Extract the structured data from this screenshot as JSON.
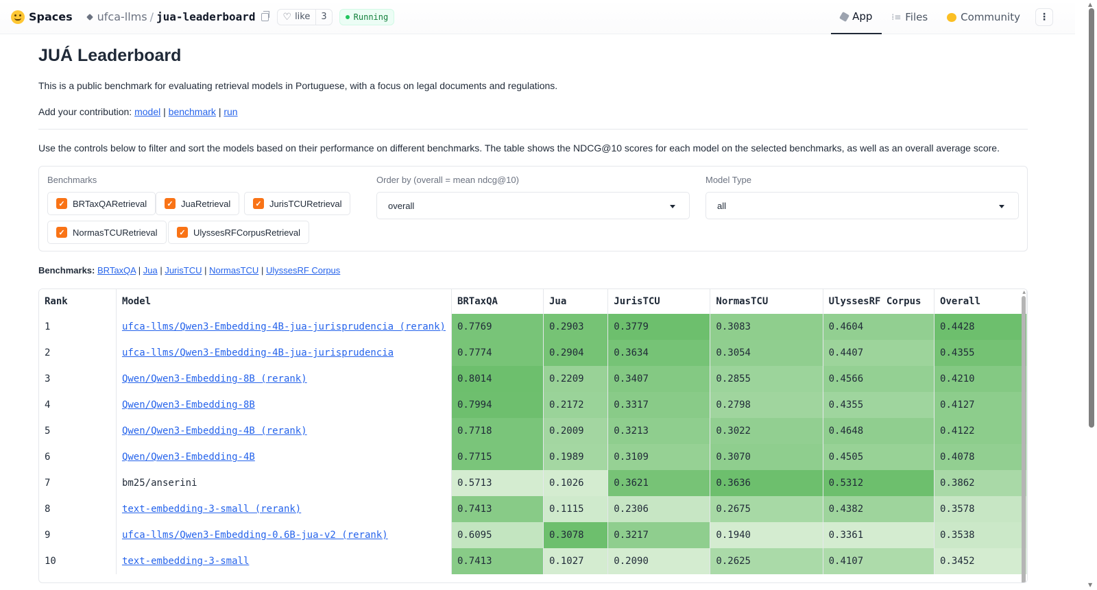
{
  "header": {
    "brand": "Spaces",
    "org": "ufca-llms",
    "repo": "jua-leaderboard",
    "like_label": "like",
    "like_count": "3",
    "status": "Running",
    "tabs": [
      {
        "label": "App",
        "icon": "app-icon",
        "active": true
      },
      {
        "label": "Files",
        "icon": "files-icon",
        "active": false
      },
      {
        "label": "Community",
        "icon": "community-icon",
        "active": false
      }
    ]
  },
  "page": {
    "title": "JUÁ Leaderboard",
    "description": "This is a public benchmark for evaluating retrieval models in Portuguese, with a focus on legal documents and regulations.",
    "contrib_prefix": "Add your contribution: ",
    "contrib_links": [
      "model",
      "benchmark",
      "run"
    ],
    "instructions": "Use the controls below to filter and sort the models based on their performance on different benchmarks. The table shows the NDCG@10 scores for each model on the selected benchmarks, as well as an overall average score."
  },
  "controls": {
    "benchmarks_label": "Benchmarks",
    "benchmarks": [
      {
        "label": "BRTaxQARetrieval",
        "checked": true
      },
      {
        "label": "JuaRetrieval",
        "checked": true
      },
      {
        "label": "JurisTCURetrieval",
        "checked": true
      },
      {
        "label": "NormasTCURetrieval",
        "checked": true
      },
      {
        "label": "UlyssesRFCorpusRetrieval",
        "checked": true
      }
    ],
    "order_label": "Order by (overall = mean ndcg@10)",
    "order_value": "overall",
    "model_type_label": "Model Type",
    "model_type_value": "all"
  },
  "bench_links": {
    "prefix": "Benchmarks:",
    "links": [
      "BRTaxQA",
      "Jua",
      "JurisTCU",
      "NormasTCU",
      "UlyssesRF Corpus"
    ]
  },
  "table": {
    "columns": [
      "Rank",
      "Model",
      "BRTaxQA",
      "Jua",
      "JurisTCU",
      "NormasTCU",
      "UlyssesRF Corpus",
      "Overall"
    ],
    "rows": [
      {
        "rank": "1",
        "model": "ufca-llms/Qwen3-Embedding-4B-jua-jurisprudencia (rerank)",
        "link": true,
        "scores": [
          "0.7769",
          "0.2903",
          "0.3779",
          "0.3083",
          "0.4604",
          "0.4428"
        ]
      },
      {
        "rank": "2",
        "model": "ufca-llms/Qwen3-Embedding-4B-jua-jurisprudencia",
        "link": true,
        "scores": [
          "0.7774",
          "0.2904",
          "0.3634",
          "0.3054",
          "0.4407",
          "0.4355"
        ]
      },
      {
        "rank": "3",
        "model": "Qwen/Qwen3-Embedding-8B (rerank)",
        "link": true,
        "scores": [
          "0.8014",
          "0.2209",
          "0.3407",
          "0.2855",
          "0.4566",
          "0.4210"
        ]
      },
      {
        "rank": "4",
        "model": "Qwen/Qwen3-Embedding-8B",
        "link": true,
        "scores": [
          "0.7994",
          "0.2172",
          "0.3317",
          "0.2798",
          "0.4355",
          "0.4127"
        ]
      },
      {
        "rank": "5",
        "model": "Qwen/Qwen3-Embedding-4B (rerank)",
        "link": true,
        "scores": [
          "0.7718",
          "0.2009",
          "0.3213",
          "0.3022",
          "0.4648",
          "0.4122"
        ]
      },
      {
        "rank": "6",
        "model": "Qwen/Qwen3-Embedding-4B",
        "link": true,
        "scores": [
          "0.7715",
          "0.1989",
          "0.3109",
          "0.3070",
          "0.4505",
          "0.4078"
        ]
      },
      {
        "rank": "7",
        "model": "bm25/anserini",
        "link": false,
        "scores": [
          "0.5713",
          "0.1026",
          "0.3621",
          "0.3636",
          "0.5312",
          "0.3862"
        ]
      },
      {
        "rank": "8",
        "model": "text-embedding-3-small (rerank)",
        "link": true,
        "scores": [
          "0.7413",
          "0.1115",
          "0.2306",
          "0.2675",
          "0.4382",
          "0.3578"
        ]
      },
      {
        "rank": "9",
        "model": "ufca-llms/Qwen3-Embedding-0.6B-jua-v2 (rerank)",
        "link": true,
        "scores": [
          "0.6095",
          "0.3078",
          "0.3217",
          "0.1940",
          "0.3361",
          "0.3538"
        ]
      },
      {
        "rank": "10",
        "model": "text-embedding-3-small",
        "link": true,
        "scores": [
          "0.7413",
          "0.1027",
          "0.2090",
          "0.2625",
          "0.4107",
          "0.3452"
        ]
      }
    ],
    "heat_colors": {
      "low": "#e6f4e2",
      "high": "#6dbf6d"
    }
  }
}
